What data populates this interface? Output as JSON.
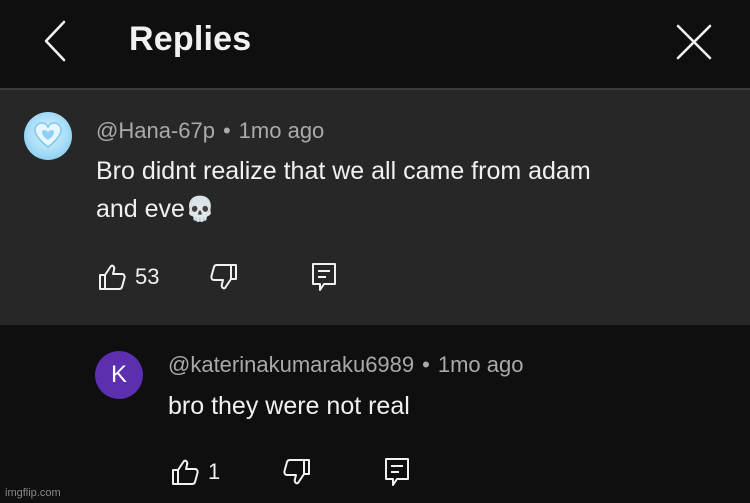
{
  "header": {
    "title": "Replies"
  },
  "parent_comment": {
    "author": "@Hana-67p",
    "separator": "•",
    "time": "1mo ago",
    "text_line1": "Bro didnt realize that we all came from adam",
    "text_line2": "and eve",
    "emoji": "💀",
    "likes": "53",
    "avatar_icon": "heart-icon"
  },
  "reply_comment": {
    "author": "@katerinakumaraku6989",
    "separator": "•",
    "time": "1mo ago",
    "text": "bro they were not real",
    "likes": "1",
    "avatar_letter": "K",
    "avatar_color": "#5b2fb0"
  },
  "watermark": "imgflip.com",
  "colors": {
    "background": "#0f0f0f",
    "highlight": "#272727",
    "secondary_text": "#aaaaaa"
  }
}
